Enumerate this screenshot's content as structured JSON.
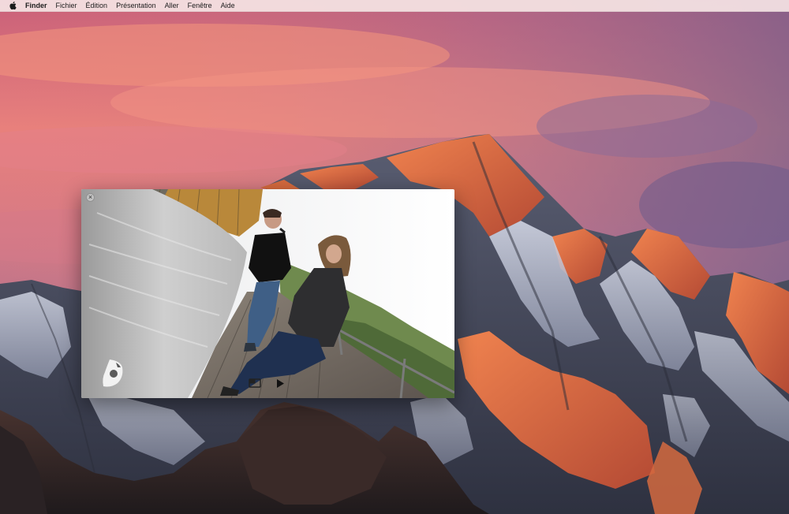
{
  "menubar": {
    "apple_icon": "apple-logo-icon",
    "items": [
      "Finder",
      "Fichier",
      "Édition",
      "Présentation",
      "Aller",
      "Fenêtre",
      "Aide"
    ]
  },
  "video_player": {
    "close_icon": "close-icon",
    "close_glyph": "×",
    "pip_icon": "picture-in-picture-icon",
    "play_icon": "play-icon",
    "logo_icon": "app-logo-icon"
  },
  "colors": {
    "menubar_bg": "#f5e4e4",
    "sky_top": "#d56f7a",
    "sky_mid": "#f0887a",
    "mountain_glow": "#e06a45",
    "mountain_shadow": "#4a4e5e"
  }
}
